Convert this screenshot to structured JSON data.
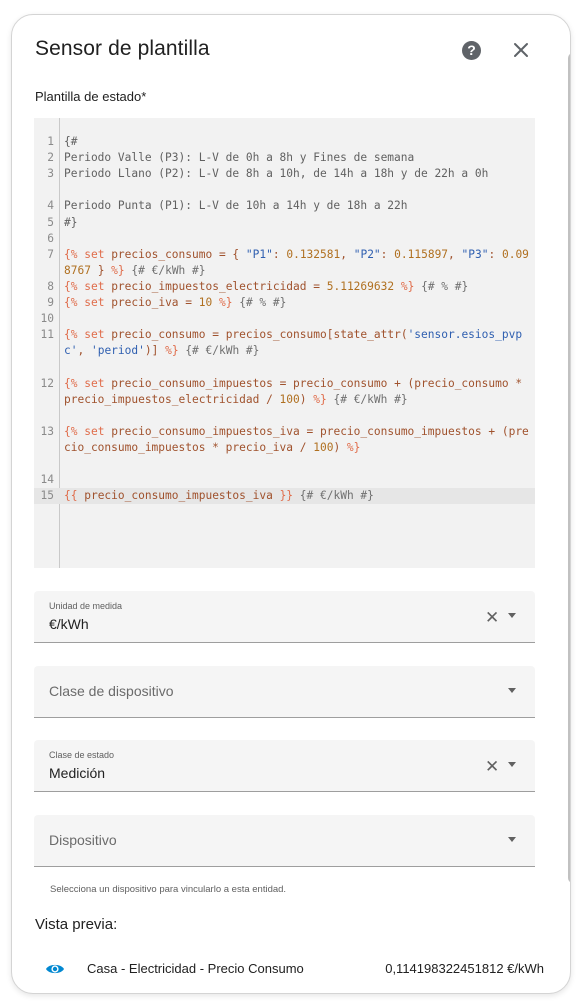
{
  "dialog": {
    "title": "Sensor de plantilla",
    "help_icon": "help-circle-icon",
    "close_icon": "close-icon"
  },
  "template": {
    "label": "Plantilla de estado*",
    "lines": [
      {
        "n": "1",
        "text": "{#"
      },
      {
        "n": "2",
        "text": "Periodo Valle (P3): L-V de 0h a 8h y Fines de semana"
      },
      {
        "n": "3",
        "text": "Periodo Llano (P2): L-V de 8h a 10h, de 14h a 18h y de 22h a 0h"
      },
      {
        "n": "4",
        "text": "Periodo Punta (P1): L-V de 10h a 14h y de 18h a 22h"
      },
      {
        "n": "5",
        "text": "#}"
      },
      {
        "n": "6",
        "text": ""
      },
      {
        "n": "7",
        "text": "{% set precios_consumo = { \"P1\": 0.132581, \"P2\": 0.115897, \"P3\": 0.098767 } %} {# €/kWh #}"
      },
      {
        "n": "8",
        "text": "{% set precio_impuestos_electricidad = 5.11269632 %} {# % #}"
      },
      {
        "n": "9",
        "text": "{% set precio_iva = 10 %} {# % #}"
      },
      {
        "n": "10",
        "text": ""
      },
      {
        "n": "11",
        "text": "{% set precio_consumo = precios_consumo[state_attr('sensor.esios_pvpc', 'period')] %} {# €/kWh #}"
      },
      {
        "n": "12",
        "text": "{% set precio_consumo_impuestos = precio_consumo + (precio_consumo * precio_impuestos_electricidad / 100) %} {# €/kWh #}"
      },
      {
        "n": "13",
        "text": "{% set precio_consumo_impuestos_iva = precio_consumo_impuestos + (precio_consumo_impuestos * precio_iva / 100) %}"
      },
      {
        "n": "14",
        "text": ""
      },
      {
        "n": "15",
        "text": "{{ precio_consumo_impuestos_iva }} {# €/kWh #}"
      }
    ],
    "active_line": "15"
  },
  "fields": {
    "unit": {
      "label": "Unidad de medida",
      "value": "€/kWh"
    },
    "device_class": {
      "placeholder": "Clase de dispositivo"
    },
    "state_class": {
      "label": "Clase de estado",
      "value": "Medición"
    },
    "device": {
      "placeholder": "Dispositivo",
      "helper": "Selecciona un dispositivo para vincularlo a esta entidad."
    }
  },
  "preview": {
    "title": "Vista previa:",
    "icon": "eye-icon",
    "accent": "#03a9f4",
    "entity_name": "Casa - Electricidad - Precio Consumo",
    "entity_value": "0,114198322451812 €/kWh"
  }
}
